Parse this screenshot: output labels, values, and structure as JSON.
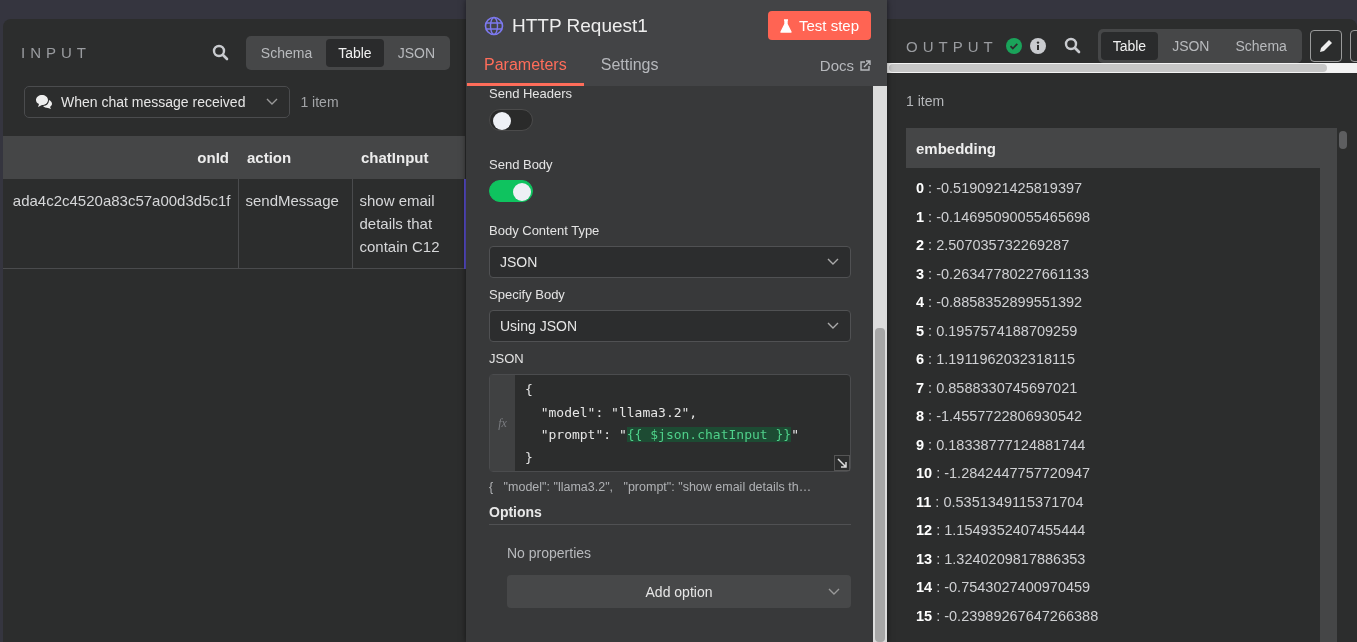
{
  "input": {
    "title": "INPUT",
    "views": [
      {
        "label": "Schema",
        "selected": false
      },
      {
        "label": "Table",
        "selected": true
      },
      {
        "label": "JSON",
        "selected": false
      }
    ],
    "source": "When chat message received",
    "item_count": "1 item",
    "table": {
      "columns": [
        "onId",
        "action",
        "chatInput"
      ],
      "rows": [
        [
          "ada4c2c4520a83c57a00d3d5c1f",
          "sendMessage",
          "show email details that contain C12"
        ]
      ]
    }
  },
  "node": {
    "title": "HTTP Request1",
    "test_button": "Test step",
    "tabs": [
      {
        "label": "Parameters",
        "selected": true
      },
      {
        "label": "Settings",
        "selected": false
      }
    ],
    "docs_link": "Docs",
    "params": [
      {
        "kind": "toggle",
        "label": "Send Headers",
        "on": false
      },
      {
        "kind": "toggle",
        "label": "Send Body",
        "on": true
      },
      {
        "kind": "select",
        "label": "Body Content Type",
        "value": "JSON"
      },
      {
        "kind": "select",
        "label": "Specify Body",
        "value": "Using JSON"
      },
      {
        "kind": "code",
        "label": "JSON",
        "gutter_label": "fx",
        "lines": [
          [
            {
              "text": "{",
              "kind": "plain"
            }
          ],
          [
            {
              "text": "  \"model\": \"llama3.2\",",
              "kind": "plain"
            }
          ],
          [
            {
              "text": "  \"prompt\": \"",
              "kind": "plain"
            },
            {
              "text": "{{ $json.chatInput }}",
              "kind": "expression"
            },
            {
              "text": "\"",
              "kind": "plain"
            }
          ],
          [
            {
              "text": "}",
              "kind": "plain"
            }
          ]
        ],
        "preview": "{   \"model\": \"llama3.2\",   \"prompt\": \"show email details th…"
      }
    ],
    "options": {
      "title": "Options",
      "empty": "No properties",
      "add_button": "Add option"
    }
  },
  "output": {
    "title": "OUTPUT",
    "views": [
      {
        "label": "Table",
        "selected": true
      },
      {
        "label": "JSON",
        "selected": false
      },
      {
        "label": "Schema",
        "selected": false
      }
    ],
    "item_count": "1 item",
    "column": "embedding",
    "separator": ":",
    "entries": [
      {
        "index": "0",
        "value": "-0.5190921425819397"
      },
      {
        "index": "1",
        "value": "-0.14695090055465698"
      },
      {
        "index": "2",
        "value": "2.507035732269287"
      },
      {
        "index": "3",
        "value": "-0.26347780227661133"
      },
      {
        "index": "4",
        "value": "-0.8858352899551392"
      },
      {
        "index": "5",
        "value": "0.1957574188709259"
      },
      {
        "index": "6",
        "value": "1.1911962032318115"
      },
      {
        "index": "7",
        "value": "0.8588330745697021"
      },
      {
        "index": "8",
        "value": "-1.4557722806930542"
      },
      {
        "index": "9",
        "value": "0.18338777124881744"
      },
      {
        "index": "10",
        "value": "-1.2842447757720947"
      },
      {
        "index": "11",
        "value": "0.5351349115371704"
      },
      {
        "index": "12",
        "value": "1.1549352407455444"
      },
      {
        "index": "13",
        "value": "1.3240209817886353"
      },
      {
        "index": "14",
        "value": "-0.7543027400970459"
      },
      {
        "index": "15",
        "value": "-0.23989267647266388"
      }
    ]
  }
}
